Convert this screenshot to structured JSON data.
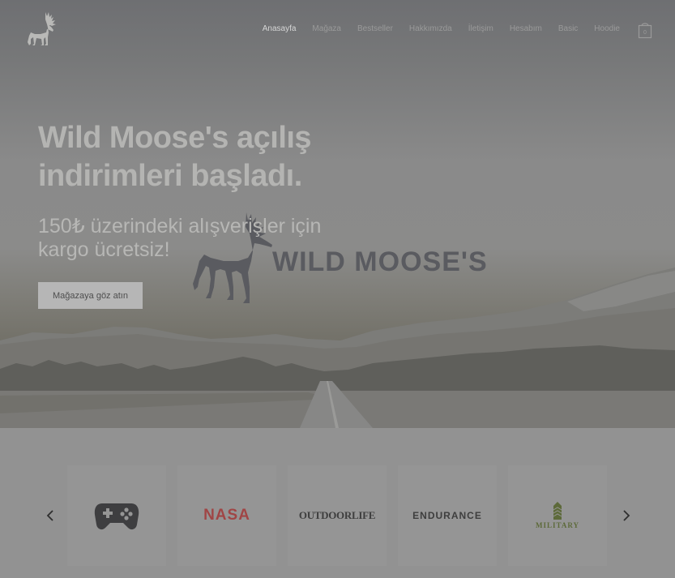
{
  "header": {
    "nav": [
      {
        "label": "Anasayfa",
        "active": true
      },
      {
        "label": "Mağaza",
        "active": false
      },
      {
        "label": "Bestseller",
        "active": false
      },
      {
        "label": "Hakkımızda",
        "active": false
      },
      {
        "label": "İletişim",
        "active": false
      },
      {
        "label": "Hesabım",
        "active": false
      },
      {
        "label": "Basic",
        "active": false
      },
      {
        "label": "Hoodie",
        "active": false
      }
    ],
    "cart_count": "0"
  },
  "hero": {
    "title": "Wild Moose's açılış indirimleri başladı.",
    "subtitle": "150₺ üzerindeki alışverişler için kargo ücretsiz!",
    "brand_text": "Wild Moose's",
    "cta_label": "Mağazaya göz atın"
  },
  "brands": {
    "prev_icon": "chevron-left-icon",
    "next_icon": "chevron-right-icon",
    "items": [
      {
        "name": "gamepad",
        "icon": "gamepad-icon",
        "text": ""
      },
      {
        "name": "nasa",
        "icon": "nasa-logo",
        "text": "NASA"
      },
      {
        "name": "outdoor-life",
        "icon": "outdoor-life-logo",
        "text": "OUTDOORLIFE"
      },
      {
        "name": "endurance",
        "icon": "endurance-logo",
        "text": "ENDURANCE"
      },
      {
        "name": "military",
        "icon": "military-logo",
        "text": "MILITARY"
      }
    ]
  },
  "colors": {
    "overlay": "#8f8f8f",
    "nasa_red": "#a04545",
    "military_green": "#5d6a3a"
  }
}
